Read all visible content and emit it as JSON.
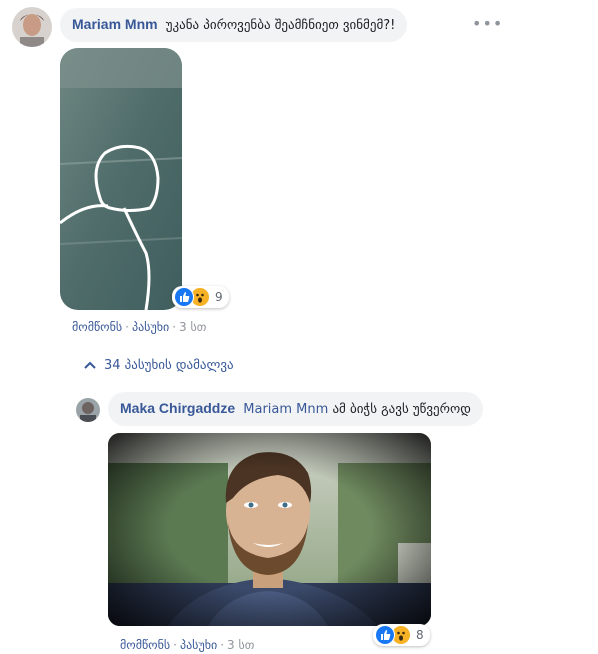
{
  "comments": [
    {
      "author": "Mariam Mnm",
      "text": "უკანა პიროვენბა შეამჩნიეთ ვინმემ?!",
      "actions": {
        "like": "მომწონს",
        "reply": "პასუხი",
        "time": "3 სთ"
      },
      "reaction_count": "9",
      "reaction_icons": [
        "like-icon",
        "wow-icon"
      ]
    }
  ],
  "replies_toggle": {
    "label": "34 პასუხის დამალვა",
    "icon": "chevron-up-icon"
  },
  "reply": {
    "author": "Maka Chirgaddze",
    "mention": "Mariam Mnm",
    "text": "ამ ბიჭს გავს უწვეროდ",
    "actions": {
      "like": "მომწონს",
      "reply": "პასუხი",
      "time": "3 სთ"
    },
    "reaction_count": "8",
    "reaction_icons": [
      "like-icon",
      "wow-icon"
    ]
  },
  "colors": {
    "link": "#385898",
    "bubble": "#f2f3f5",
    "like": "#1877f2",
    "wow": "#f7b125"
  }
}
